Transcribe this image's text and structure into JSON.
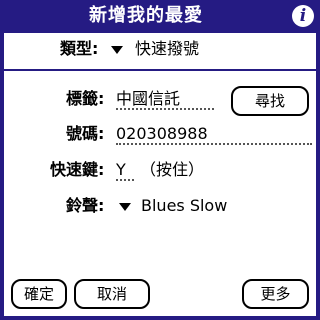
{
  "title": "新增我的最愛",
  "category": {
    "label": "類型:",
    "value": "快速撥號"
  },
  "fields": {
    "tag": {
      "label": "標籤:",
      "value": "中國信託"
    },
    "number": {
      "label": "號碼:",
      "value": "020308988"
    },
    "shortcut": {
      "label": "快速鍵:",
      "value": "Y",
      "hint": "（按住）"
    },
    "ringtone": {
      "label": "鈴聲:",
      "value": "Blues Slow"
    }
  },
  "buttons": {
    "find": "尋找",
    "ok": "確定",
    "cancel": "取消",
    "more": "更多"
  },
  "colors": {
    "accent": "#251b83"
  },
  "icons": {
    "info": "info-icon",
    "dropdown": "dropdown-arrow-icon"
  }
}
